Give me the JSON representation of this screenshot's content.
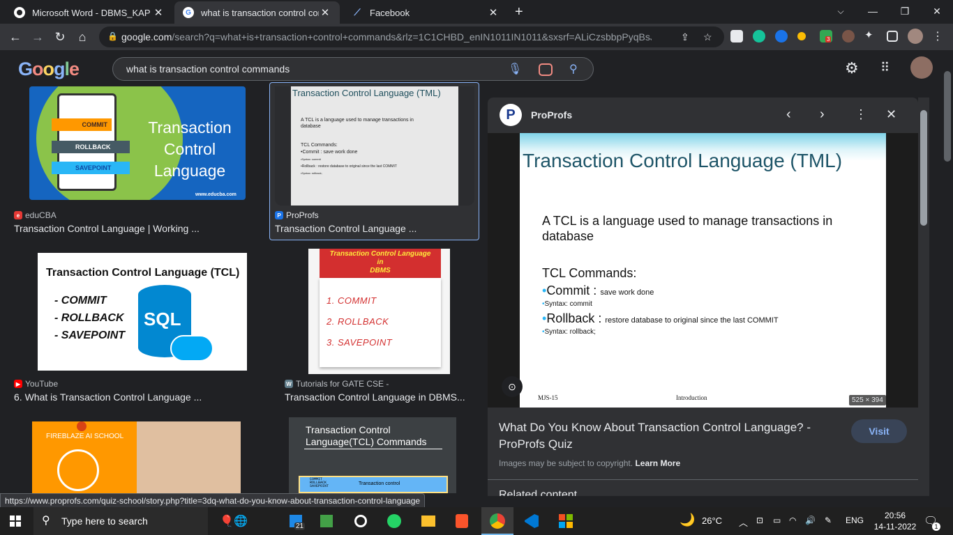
{
  "tabs": [
    {
      "title": "Microsoft Word - DBMS_KAP",
      "favicon": "chrome-icon"
    },
    {
      "title": "what is transaction control comm",
      "favicon": "google-icon"
    },
    {
      "title": "Facebook",
      "favicon": "facebook-icon"
    }
  ],
  "toolbar": {
    "url_domain": "google.com",
    "url_rest": "/search?q=what+is+transaction+control+commands&rlz=1C1CHBD_enIN1011IN1011&sxsrf=ALiCzsbbpPyqBsJLSz...",
    "ext_badge": "3"
  },
  "google": {
    "logo": "Google",
    "query": "what is transaction control commands"
  },
  "results": [
    {
      "source": "eduCBA",
      "title": "Transaction Control Language | Working ...",
      "img_title": [
        "Transaction",
        "Control",
        "Language"
      ],
      "img_items": [
        "COMMIT",
        "ROLLBACK",
        "SAVEPOINT"
      ],
      "img_url": "www.educba.com"
    },
    {
      "source": "ProProfs",
      "title": "Transaction Control Language ...",
      "img_heading": "Transaction Control Language (TML)",
      "img_lines": [
        "A TCL is a language used to manage transactions in",
        "database",
        "TCL Commands:",
        "•Commit : save work done",
        "•Syntax: commit",
        "•Rollback : restore database to original since the last COMMIT",
        "•Syntax: rollback;"
      ]
    },
    {
      "source": "YouTube",
      "title": "6. What is Transaction Control Language ...",
      "img_heading": "Transaction Control Language (TCL)",
      "img_items": [
        "- COMMIT",
        "- ROLLBACK",
        "- SAVEPOINT"
      ],
      "img_badge": "SQL"
    },
    {
      "source": "Tutorials for GATE CSE -",
      "title": "Transaction Control Language in DBMS...",
      "img_heading": [
        "Transaction Control Language",
        "in",
        "DBMS"
      ],
      "img_items": [
        "1. COMMIT",
        "2. ROLLBACK",
        "3. SAVEPOINT"
      ]
    },
    {
      "img_brand": "FIREBLAZE AI SCHOOL"
    },
    {
      "img_heading": [
        "Transaction Control",
        "Language(TCL) Commands"
      ],
      "img_items": [
        "COMMIT",
        "ROLLBACK",
        "SAVEPOINT"
      ],
      "img_caption": "Transaction control"
    }
  ],
  "panel": {
    "source": "ProProfs",
    "slide_title": "Transaction Control Language (TML)",
    "slide_p1": "A TCL is a language used  to manage transactions in",
    "slide_p2": "database",
    "slide_cmds": "TCL Commands:",
    "commit": "Commit : ",
    "commit_desc": "save work done",
    "syntax_commit": "Syntax: commit",
    "rollback": "Rollback : ",
    "rollback_desc": "restore database to original since the last COMMIT",
    "syntax_rollback": "Syntax: rollback;",
    "footer_left": "MJS-15",
    "footer_mid": "Introduction",
    "dimensions": "525 × 394",
    "title": "What Do You Know About Transaction Control Language? - ProProfs Quiz",
    "visit": "Visit",
    "copyright": "Images may be subject to copyright.",
    "learn_more": "Learn More",
    "related": "Related content"
  },
  "status_url": "https://www.proprofs.com/quiz-school/story.php?title=3dq-what-do-you-know-about-transaction-control-language",
  "taskbar": {
    "search_placeholder": "Type here to search",
    "badge": "21",
    "weather": "26°C",
    "lang": "ENG",
    "time": "20:56",
    "date": "14-11-2022",
    "notif": "1"
  }
}
